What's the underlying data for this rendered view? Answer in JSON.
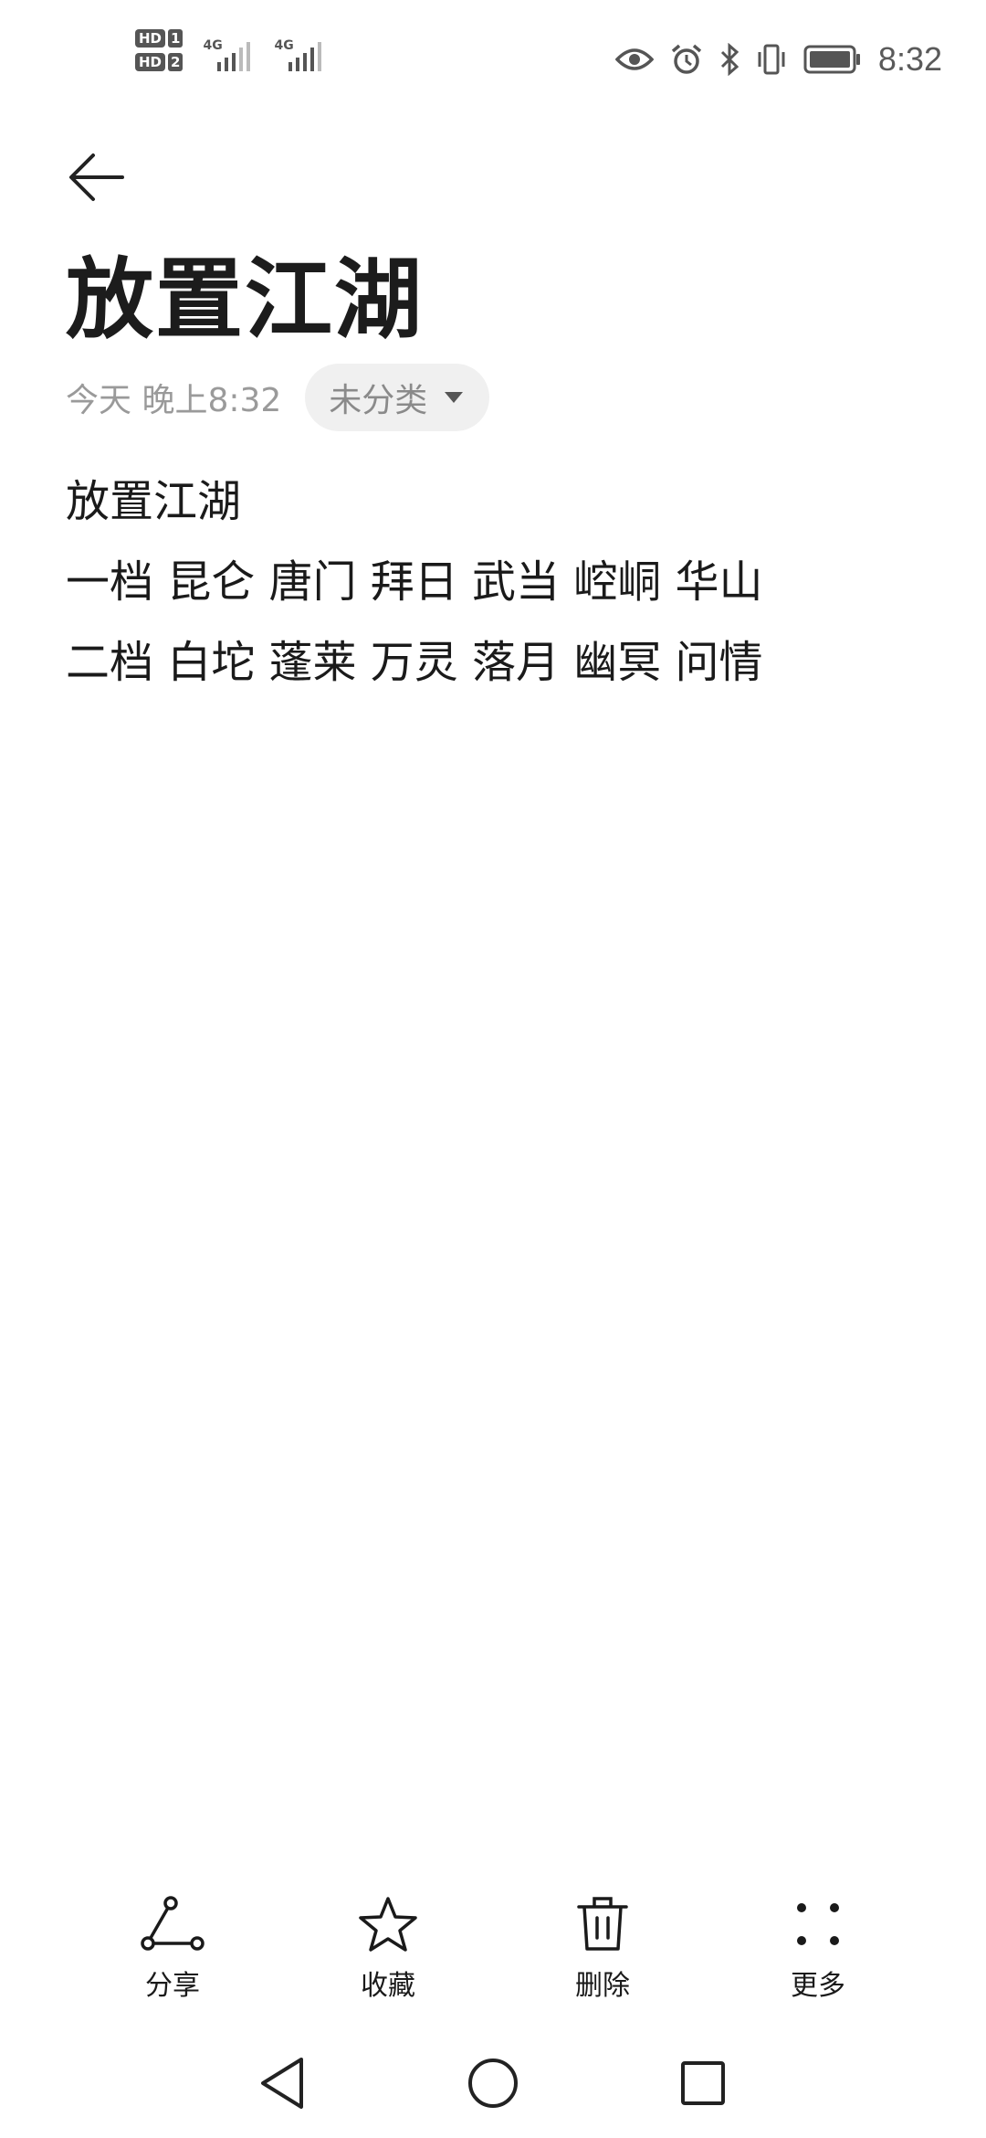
{
  "status_bar": {
    "sim1_label": "HD",
    "sim1_num": "1",
    "sim2_label": "HD",
    "sim2_num": "2",
    "network1": "4G",
    "network2": "4G",
    "icons": [
      "eye-icon",
      "alarm-icon",
      "bluetooth-icon",
      "vibrate-icon",
      "battery-icon"
    ],
    "time": "8:32"
  },
  "header": {
    "back_icon": "arrow-left-icon"
  },
  "note": {
    "title": "放置江湖",
    "timestamp": "今天 晚上8:32",
    "category": "未分类",
    "lines": [
      "放置江湖",
      "一档 昆仑 唐门 拜日 武当 崆峒 华山",
      "二档 白坨 蓬莱 万灵 落月 幽冥 问情"
    ]
  },
  "toolbar": {
    "share_label": "分享",
    "favorite_label": "收藏",
    "delete_label": "删除",
    "more_label": "更多"
  },
  "nav_bar": {
    "icons": [
      "back-triangle-icon",
      "home-circle-icon",
      "recents-square-icon"
    ]
  }
}
